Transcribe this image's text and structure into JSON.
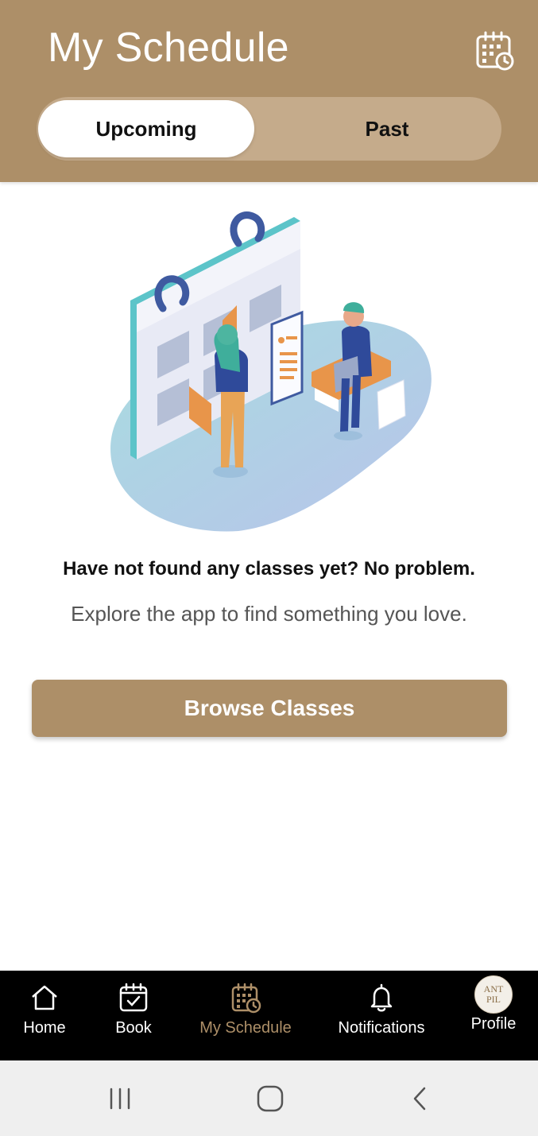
{
  "header": {
    "title": "My Schedule",
    "calendar_icon": "calendar-clock-icon",
    "tabs": [
      {
        "label": "Upcoming",
        "active": true
      },
      {
        "label": "Past",
        "active": false
      }
    ]
  },
  "empty_state": {
    "illustration": "calendar-people-illustration",
    "title": "Have not found any classes yet? No problem.",
    "subtitle": "Explore the app to find something you love.",
    "button_label": "Browse Classes"
  },
  "bottom_nav": {
    "items": [
      {
        "label": "Home",
        "icon": "home-icon",
        "active": false
      },
      {
        "label": "Book",
        "icon": "calendar-check-icon",
        "active": false
      },
      {
        "label": "My Schedule",
        "icon": "calendar-clock-icon",
        "active": true
      },
      {
        "label": "Notifications",
        "icon": "bell-icon",
        "active": false
      },
      {
        "label": "Profile",
        "icon": "avatar",
        "active": false
      }
    ],
    "avatar_text": [
      "ANT",
      "PIL"
    ]
  },
  "system_nav": {
    "buttons": [
      "recents-icon",
      "home-circle-icon",
      "back-icon"
    ]
  },
  "colors": {
    "brand": "#ad8f68",
    "segment_track": "#c5ab8b",
    "nav_background": "#000000",
    "system_bar": "#efefef"
  }
}
